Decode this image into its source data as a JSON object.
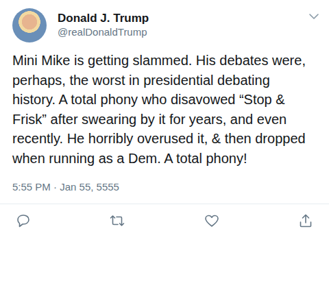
{
  "tweet": {
    "author": {
      "name": "Donald J. Trump",
      "handle": "@realDonaldTrump"
    },
    "text": "Mini Mike is getting slammed. His debates were, perhaps, the worst in presidential debating history. A total phony who disavowed “Stop & Frisk” after swearing by it for years, and even recently. He horribly overused it, & then dropped when running as a Dem. A total phony!",
    "timestamp": "5:55 PM · Jan 55, 5555"
  }
}
